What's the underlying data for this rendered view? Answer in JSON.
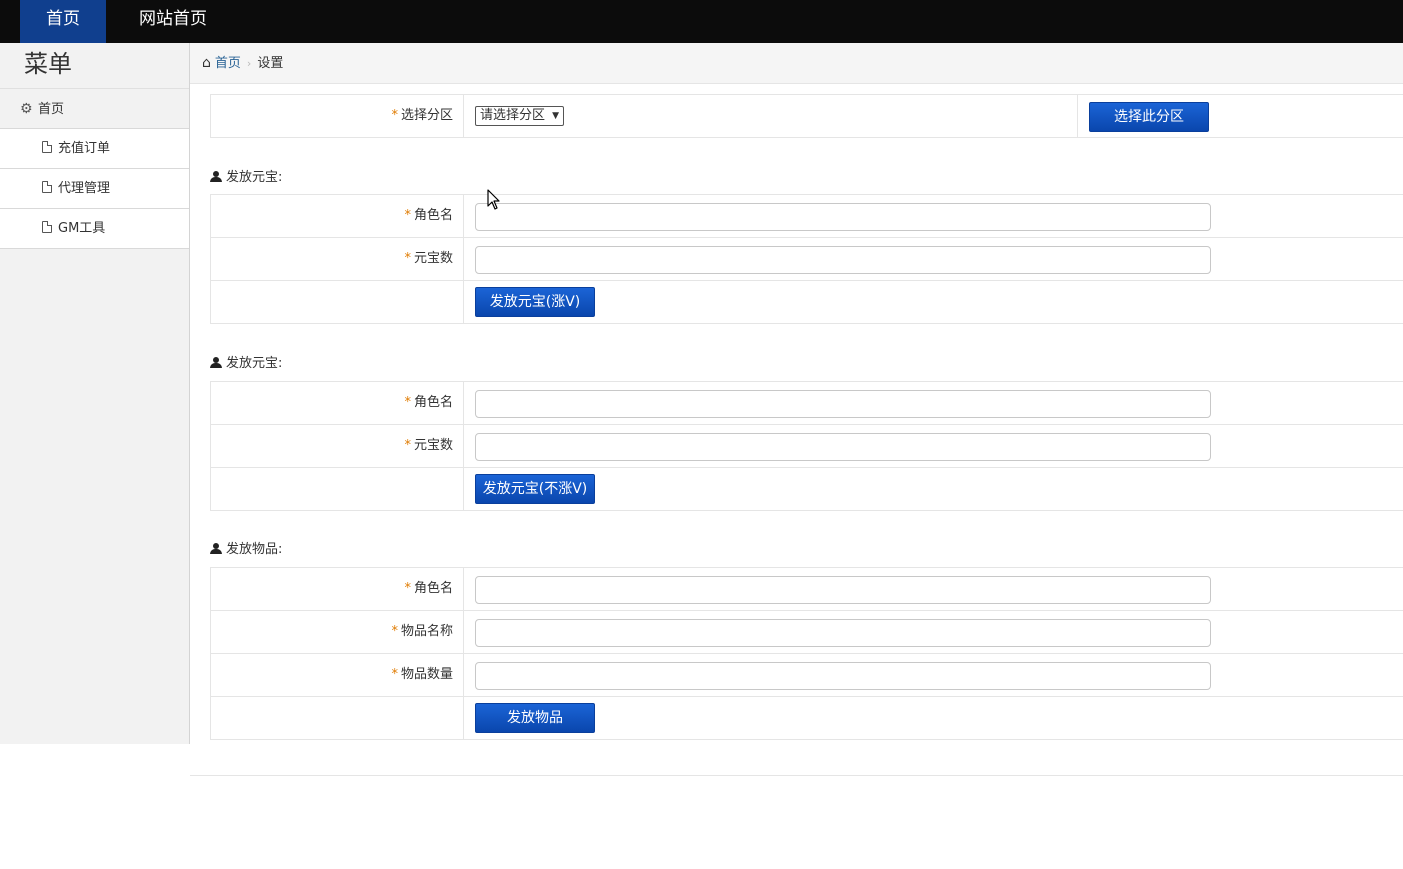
{
  "topnav": {
    "home": "首页",
    "site_home": "网站首页"
  },
  "sidebar": {
    "title": "菜单",
    "home": "首页",
    "items": [
      {
        "label": "充值订单"
      },
      {
        "label": "代理管理"
      },
      {
        "label": "GM工具"
      }
    ]
  },
  "breadcrumb": {
    "home": "首页",
    "current": "设置"
  },
  "zone": {
    "label": "选择分区",
    "select_value": "请选择分区",
    "button": "选择此分区"
  },
  "section1": {
    "title": "发放元宝:",
    "role_label": "角色名",
    "amount_label": "元宝数",
    "button": "发放元宝(涨V)"
  },
  "section2": {
    "title": "发放元宝:",
    "role_label": "角色名",
    "amount_label": "元宝数",
    "button": "发放元宝(不涨V)"
  },
  "section3": {
    "title": "发放物品:",
    "role_label": "角色名",
    "item_name_label": "物品名称",
    "item_qty_label": "物品数量",
    "button": "发放物品"
  },
  "required_mark": "*",
  "colors": {
    "topbar": "#0c0c0c",
    "nav_active": "#103f8e",
    "button": "#0a46ad",
    "required": "#e07b00"
  }
}
